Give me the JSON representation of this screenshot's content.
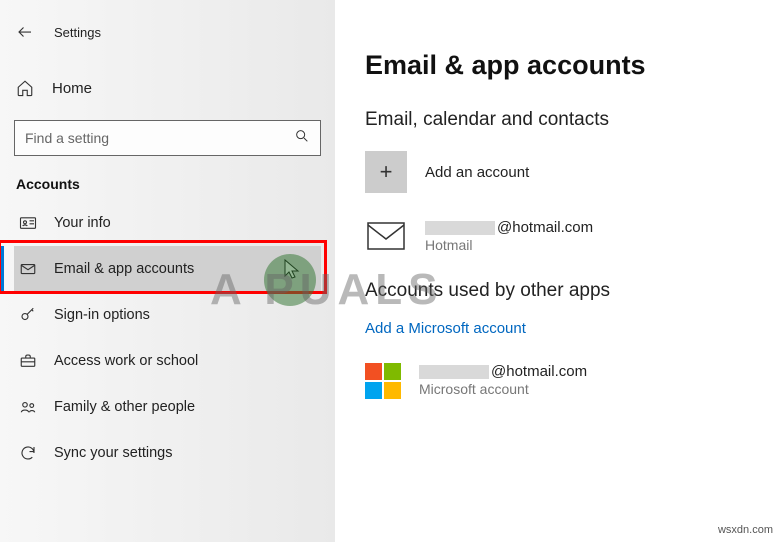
{
  "header": {
    "title": "Settings"
  },
  "sidebar": {
    "home_label": "Home",
    "search_placeholder": "Find a setting",
    "section_label": "Accounts",
    "items": [
      {
        "label": "Your info"
      },
      {
        "label": "Email & app accounts"
      },
      {
        "label": "Sign-in options"
      },
      {
        "label": "Access work or school"
      },
      {
        "label": "Family & other people"
      },
      {
        "label": "Sync your settings"
      }
    ]
  },
  "main": {
    "heading": "Email & app accounts",
    "section1_heading": "Email, calendar and contacts",
    "add_account_label": "Add an account",
    "account1": {
      "email_suffix": "@hotmail.com",
      "provider": "Hotmail"
    },
    "section2_heading": "Accounts used by other apps",
    "add_ms_account_label": "Add a Microsoft account",
    "account2": {
      "email_suffix": "@hotmail.com",
      "provider": "Microsoft account"
    }
  },
  "watermark": "A  PUALS",
  "credit": "wsxdn.com"
}
